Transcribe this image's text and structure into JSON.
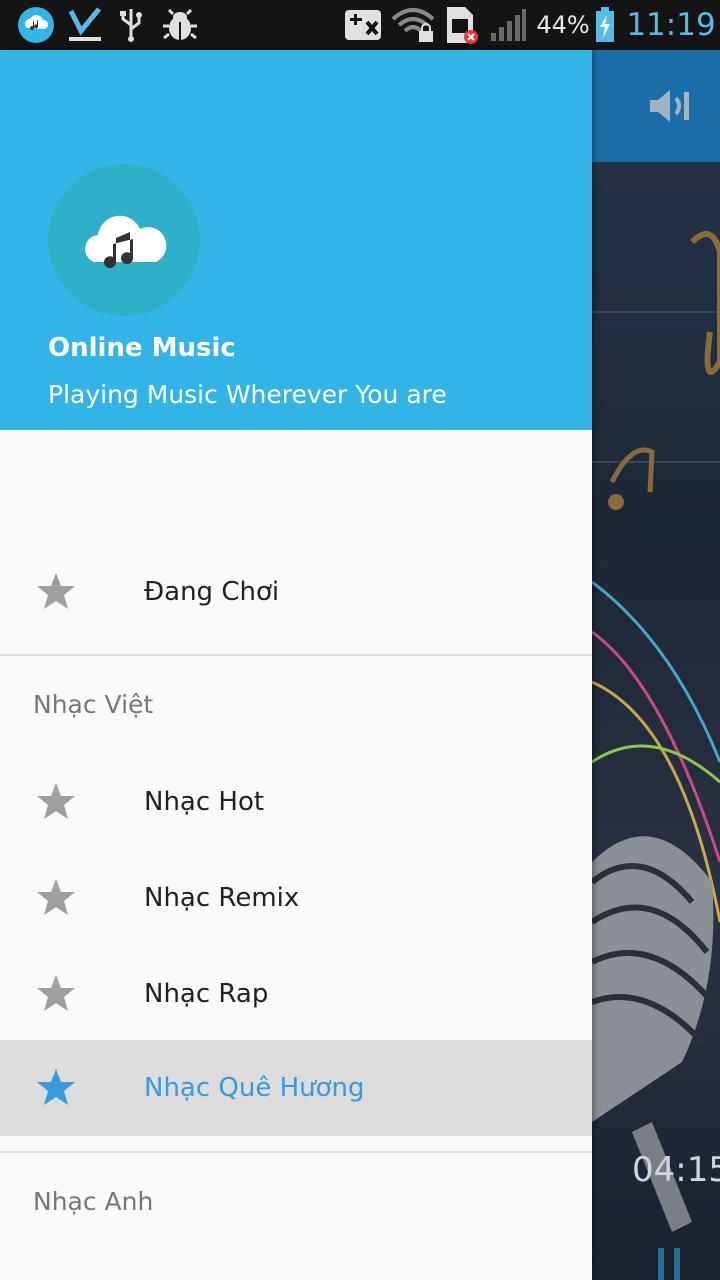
{
  "status_bar": {
    "battery_percent": "44%",
    "clock": "11:19",
    "icons": [
      "music-app-icon",
      "download-done-icon",
      "usb-icon",
      "debug-icon",
      "screenshot-icon",
      "wifi-lock-icon",
      "sim-error-icon",
      "signal-icon",
      "battery-charging-icon"
    ]
  },
  "drawer": {
    "header": {
      "app_name": "Online Music",
      "tagline": "Playing Music Wherever You are",
      "logo_icon": "cloud-music-icon"
    },
    "items": [
      {
        "label": "Đang Chơi",
        "icon": "star-icon",
        "active": false
      },
      {
        "section": "Nhạc Việt"
      },
      {
        "label": "Nhạc Hot",
        "icon": "star-icon",
        "active": false
      },
      {
        "label": "Nhạc Remix",
        "icon": "star-icon",
        "active": false
      },
      {
        "label": "Nhạc Rap",
        "icon": "star-icon",
        "active": false
      },
      {
        "label": "Nhạc Quê Hương",
        "icon": "star-icon",
        "active": true
      },
      {
        "section": "Nhạc Anh"
      }
    ],
    "colors": {
      "header_bg": "#33b4e6",
      "active_text": "#3a9bdc",
      "active_bg": "#dcdcdc",
      "icon_inactive": "#9e9e9e"
    }
  },
  "background": {
    "time_partial": "04:15",
    "toolbar_icon": "volume-icon",
    "control_icon": "pause-icon"
  }
}
